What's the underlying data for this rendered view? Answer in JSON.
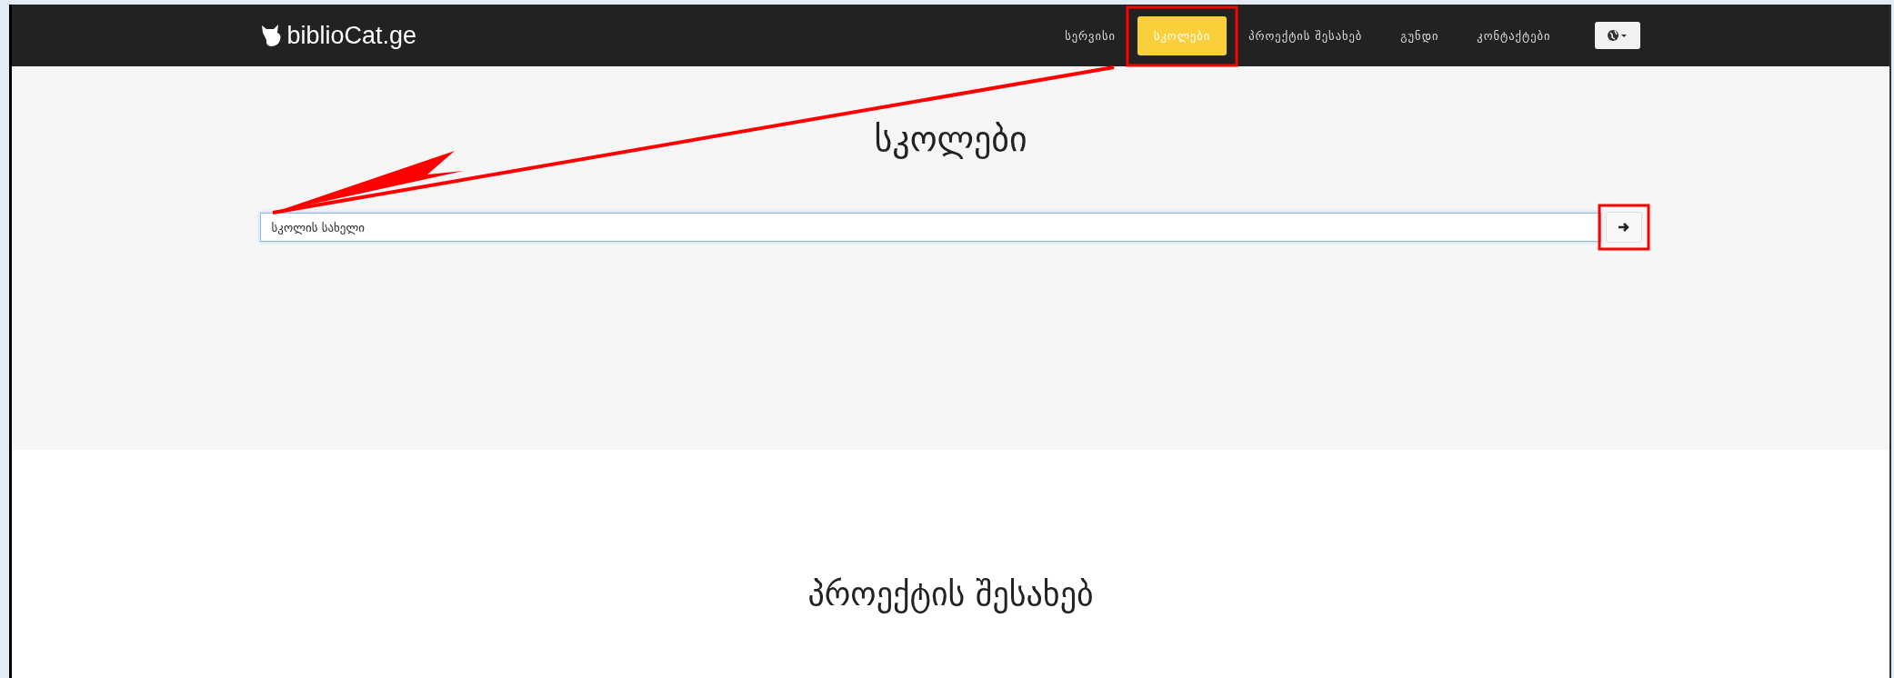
{
  "navbar": {
    "brand": "biblioCat.ge",
    "items": [
      {
        "label": "სერვისი",
        "selected": false
      },
      {
        "label": "სკოლები",
        "selected": true
      },
      {
        "label": "პროექტის შესახებ",
        "selected": false
      },
      {
        "label": "გუნდი",
        "selected": false
      },
      {
        "label": "კონტაქტები",
        "selected": false
      }
    ]
  },
  "hero": {
    "title": "სკოლები",
    "search": {
      "placeholder": "სკოლის სახელი"
    }
  },
  "about": {
    "title": "პროექტის შესახებ"
  }
}
